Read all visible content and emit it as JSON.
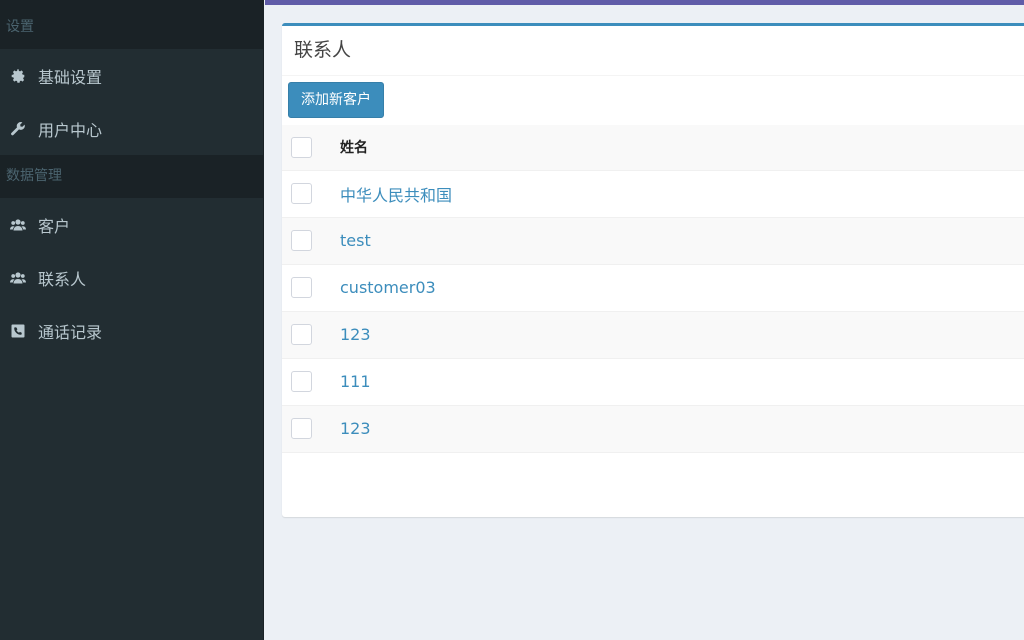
{
  "sidebar": {
    "sections": [
      {
        "header": "设置",
        "items": [
          {
            "label": "基础设置",
            "icon": "gear-icon"
          },
          {
            "label": "用户中心",
            "icon": "wrench-icon"
          }
        ]
      },
      {
        "header": "数据管理",
        "items": [
          {
            "label": "客户",
            "icon": "users-icon"
          },
          {
            "label": "联系人",
            "icon": "users-icon"
          },
          {
            "label": "通话记录",
            "icon": "phone-icon"
          }
        ]
      }
    ]
  },
  "panel": {
    "title": "联系人",
    "add_button_label": "添加新客户"
  },
  "table": {
    "columns": [
      "姓名"
    ],
    "rows": [
      {
        "name": "中华人民共和国"
      },
      {
        "name": "test"
      },
      {
        "name": "customer03"
      },
      {
        "name": "123"
      },
      {
        "name": "111"
      },
      {
        "name": "123"
      }
    ]
  },
  "colors": {
    "sidebar_bg": "#222d32",
    "accent": "#3c8dbc",
    "topbar": "#605ca8"
  }
}
